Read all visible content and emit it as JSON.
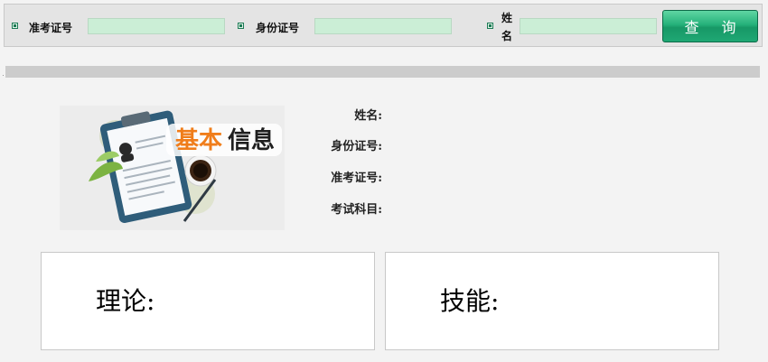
{
  "search": {
    "exam_no": {
      "label": "准考证号",
      "value": ""
    },
    "id_no": {
      "label": "身份证号",
      "value": ""
    },
    "name": {
      "label_line1": "姓",
      "label_line2": "名",
      "value": ""
    },
    "query_button": "查 询"
  },
  "info": {
    "banner_text_a": "基本",
    "banner_text_b": "信息",
    "name_label": "姓名:",
    "id_label": "身份证号:",
    "exam_label": "准考证号:",
    "subject_label": "考试科目:"
  },
  "scores": {
    "theory_label": "理论:",
    "skill_label": "技能:"
  },
  "colors": {
    "accent": "#1fa874",
    "input_bg": "#cbeed6",
    "banner_orange": "#f07d1a"
  }
}
